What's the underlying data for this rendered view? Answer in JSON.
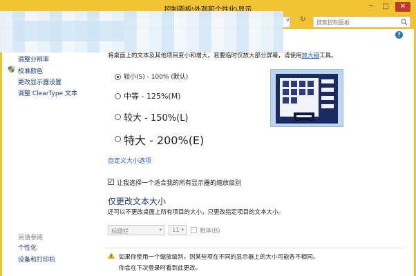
{
  "window": {
    "title": "控制面板\\外观和个性化\\显示",
    "minimize": "─",
    "maximize": "□",
    "close": "✕",
    "search_placeholder": "搜索控制面板",
    "refresh": "↻",
    "chevron": "v"
  },
  "help": {
    "label": "?"
  },
  "sidebar": {
    "items": [
      {
        "label": "调整分辨率"
      },
      {
        "label": "校准颜色",
        "icon": "shield-icon"
      },
      {
        "label": "更改显示器设置"
      },
      {
        "label": "调整 ClearType 文本"
      }
    ],
    "see_also": "另请参阅",
    "see_also_items": [
      {
        "label": "个性化"
      },
      {
        "label": "设备和打印机"
      }
    ]
  },
  "main": {
    "description_prefix": "将桌面上的文本及其他项目变小和增大。若要临时仅放大部分屏幕，请使用",
    "description_link": "放大镜",
    "description_suffix": "工具。",
    "options": [
      {
        "label": "较小(S) - 100% (默认)",
        "checked": true
      },
      {
        "label": "中等 - 125%(M)",
        "checked": false
      },
      {
        "label": "较大 - 150%(L)",
        "checked": false
      },
      {
        "label": "特大 - 200%(E)",
        "checked": false
      }
    ],
    "custom_sizing": "自定义大小选项",
    "checkbox_label": "让我选择一个适合我的所有显示器的缩放级别",
    "checkbox_checked": true,
    "checkbox_mark": "✓",
    "text_section_title": "仅更改文本大小",
    "text_section_desc": "还可以不更改桌面上所有项目的大小，只更改指定项目的文本大小。",
    "item_select": "标题栏",
    "size_select": "11",
    "bold_label": "粗体(B)",
    "caret": "▾",
    "warning_line1": "如果你使用一个缩放级别，则某些项在不同的显示器上的大小可能各不相同。",
    "warning_line2": "你会在下次登录时看到此更改。"
  }
}
